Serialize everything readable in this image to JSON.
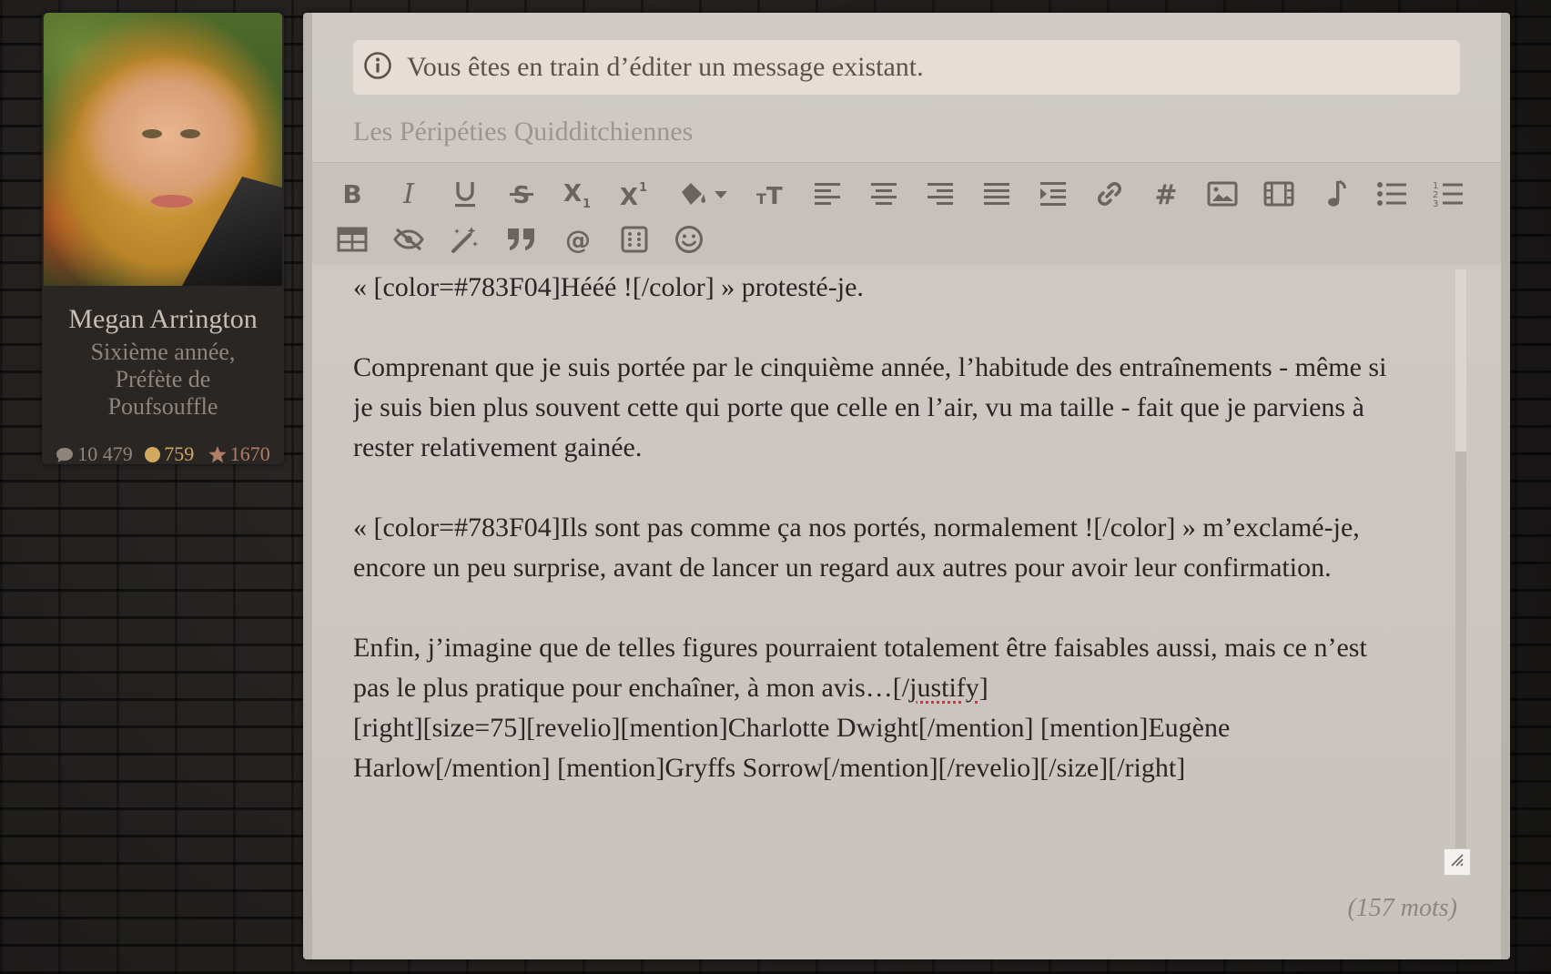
{
  "profile": {
    "name": "Megan Arrington",
    "rank_line1": "Sixième année,",
    "rank_line2": "Préfète de",
    "rank_line3": "Poufsouffle",
    "messages": "10 479",
    "coins": "759",
    "points": "1670"
  },
  "editor": {
    "notice": "Vous êtes en train d’éditer un message existant.",
    "subject_placeholder": "Les Péripéties Quidditchiennes",
    "word_count": "(157 mots)"
  },
  "toolbar": {
    "row1": [
      "bold-icon",
      "italic-icon",
      "underline-icon",
      "strikethrough-icon",
      "subscript-icon",
      "superscript-icon",
      "color-fill-icon",
      "font-size-icon",
      "align-left-icon",
      "align-center-icon",
      "align-right-icon",
      "align-justify-icon",
      "indent-icon",
      "link-icon",
      "hashtag-icon",
      "image-icon",
      "video-icon",
      "music-icon",
      "bullet-list-icon",
      "numbered-list-icon"
    ],
    "row2": [
      "table-icon",
      "hide-icon",
      "magic-wand-icon",
      "quote-icon",
      "mention-icon",
      "dice-icon",
      "emoji-icon"
    ]
  },
  "content": {
    "p1": "« [color=#783F04]Hééé ![/color] » protesté-je.",
    "p2": "Comprenant que je suis portée par le cinquième année, l’habitude des entraînements - même si je suis bien plus souvent cette qui porte que celle en l’air, vu ma taille - fait que je parviens à rester relativement gainée.",
    "p3": "« [color=#783F04]Ils sont pas comme ça nos portés, normalement ![/color] » m’exclamé-je, encore un peu surprise, avant de lancer un regard aux autres pour avoir leur confirmation.",
    "p4a": "Enfin, j’imagine que de telles figures pourraient totalement être faisables aussi, mais ce n’est pas le plus pratique pour enchaîner, à mon avis…[/",
    "p4b": "justify",
    "p4c": "]",
    "p5": "[right][size=75][revelio][mention]Charlotte Dwight[/mention] [mention]Eugène Harlow[/mention] [mention]Gryffs Sorrow[/mention][/revelio][/size][/right]"
  }
}
